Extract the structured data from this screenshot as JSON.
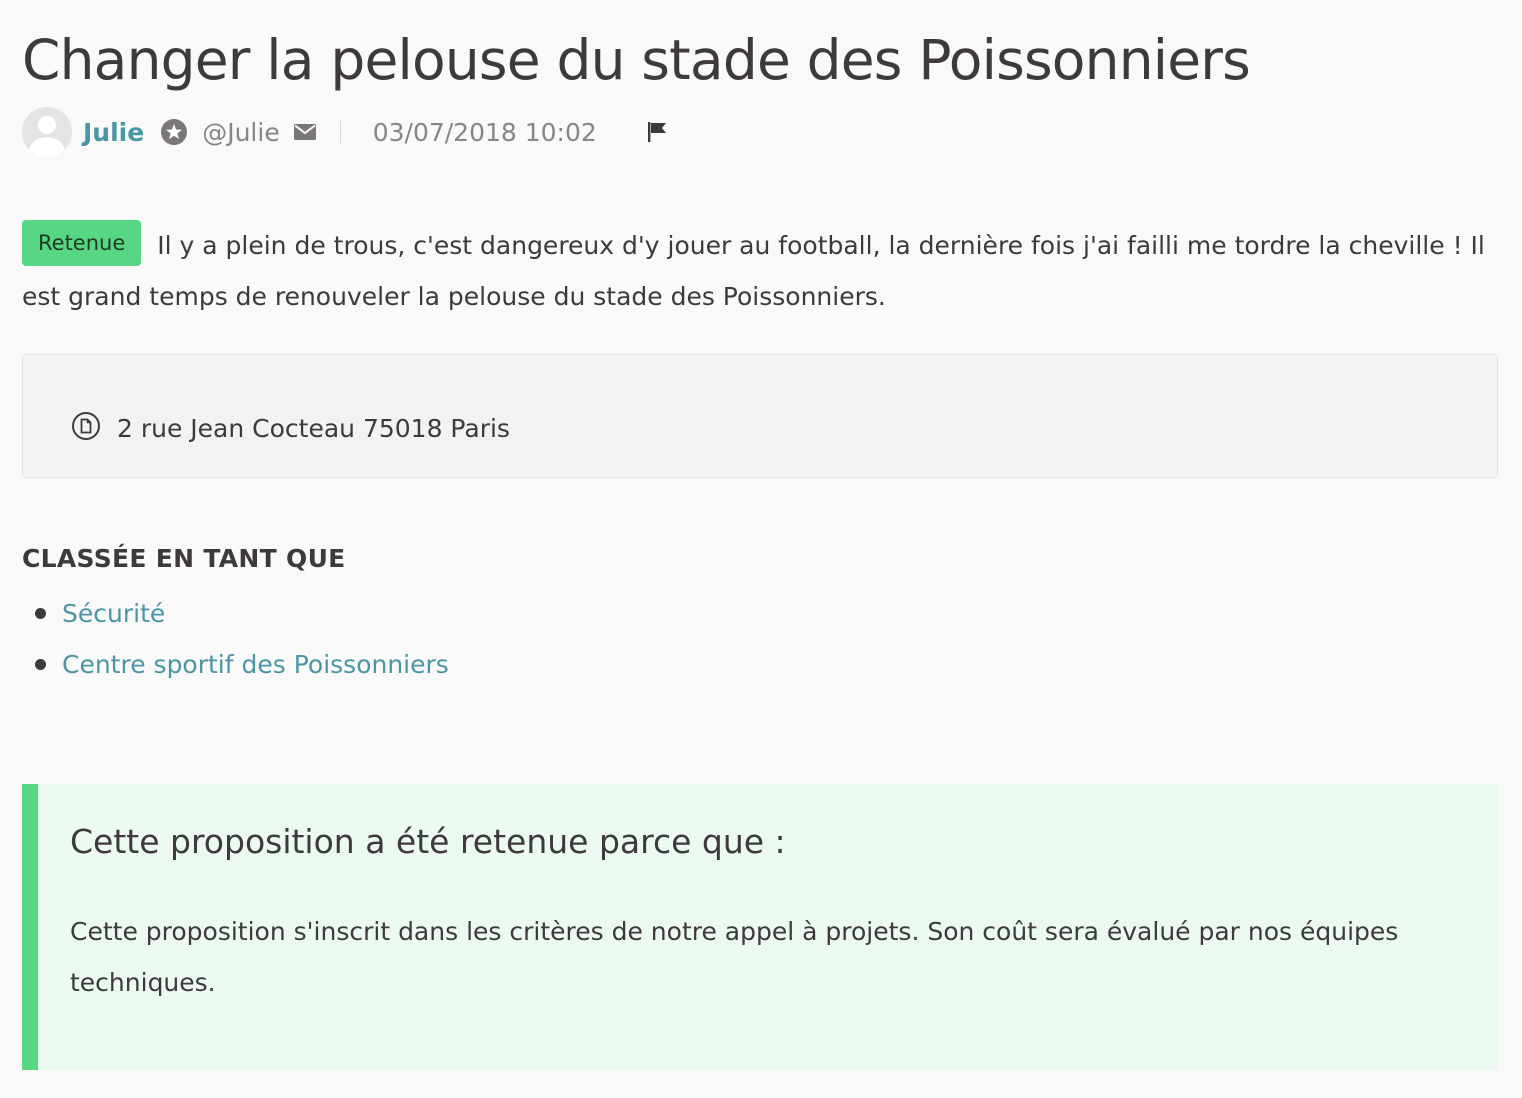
{
  "proposal": {
    "title": "Changer la pelouse du stade des Poissonniers",
    "author": {
      "name": "Julie",
      "nickname": "@Julie"
    },
    "date": "03/07/2018 10:02",
    "status": "Retenue",
    "body": "Il y a plein de trous, c'est dangereux d'y jouer au football, la dernière fois j'ai failli me tordre la cheville ! Il est grand temps de renouveler la pelouse du stade des Poissonniers.",
    "address": "2 rue Jean Cocteau 75018 Paris"
  },
  "categories": {
    "heading": "CLASSÉE EN TANT QUE",
    "items": [
      {
        "label": "Sécurité"
      },
      {
        "label": "Centre sportif des Poissonniers"
      }
    ]
  },
  "answer": {
    "title": "Cette proposition a été retenue parce que :",
    "body": "Cette proposition s'inscrit dans les critères de notre appel à projets. Son coût sera évalué par nos équipes techniques."
  },
  "icons": {
    "avatar": "avatar-placeholder",
    "badge": "star-badge-icon",
    "mail": "envelope-icon",
    "flag": "flag-icon",
    "address": "document-circle-icon"
  },
  "colors": {
    "link": "#4b96a5",
    "accent_green": "#57d684",
    "answer_bg": "#ecf9f0",
    "text": "#3d393c",
    "muted": "#8a8487"
  }
}
